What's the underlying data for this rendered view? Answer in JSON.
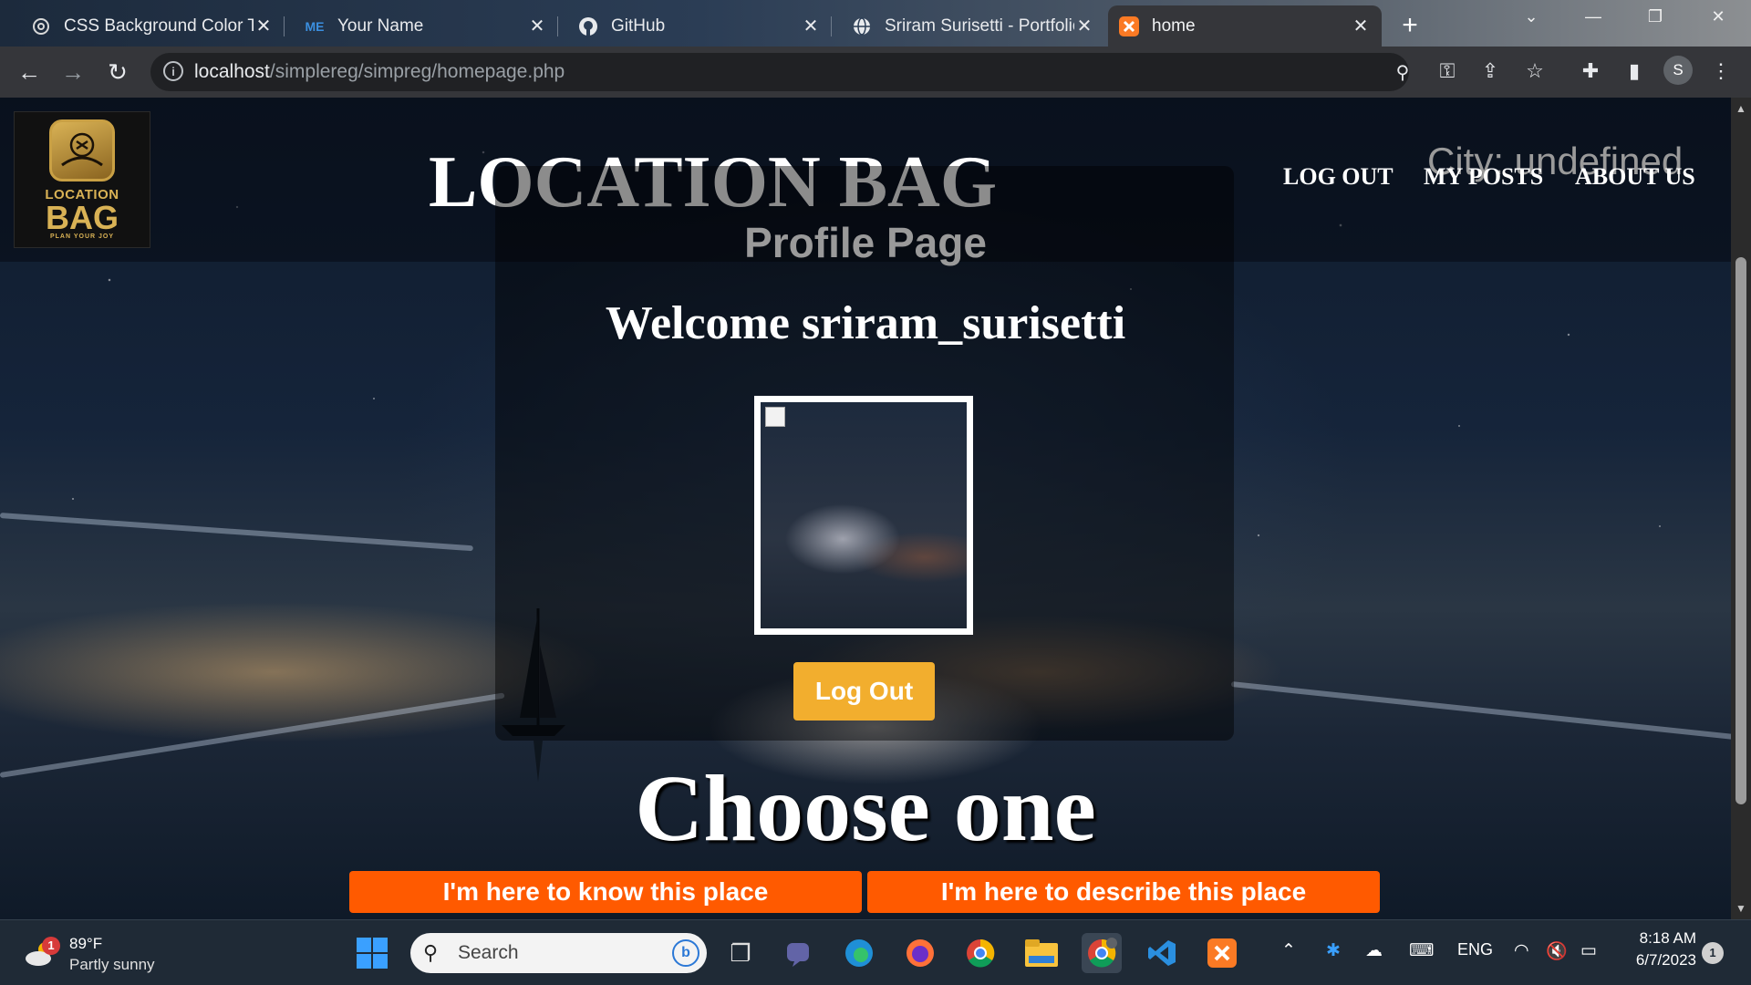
{
  "browser": {
    "tabs": [
      {
        "title": "CSS Background Color Tra",
        "icon": "chatgpt-icon"
      },
      {
        "title": "Your Name",
        "icon": "me-icon"
      },
      {
        "title": "GitHub",
        "icon": "github-icon"
      },
      {
        "title": "Sriram Surisetti - Portfolio",
        "icon": "globe-icon"
      },
      {
        "title": "home",
        "icon": "xampp-icon",
        "active": true
      }
    ],
    "url_host": "localhost",
    "url_path": "/simplereg/simpreg/homepage.php",
    "profile_initial": "S"
  },
  "site": {
    "logo": {
      "line1": "LOCATION",
      "line2": "BAG",
      "tagline": "PLAN YOUR JOY"
    },
    "title": "LOCATION BAG",
    "city": "City: undefined",
    "nav": [
      "LOG OUT",
      "MY POSTS",
      "ABOUT US"
    ]
  },
  "profile": {
    "heading": "Profile Page",
    "welcome": "Welcome sriram_surisetti",
    "logout_label": "Log Out"
  },
  "choose": {
    "heading": "Choose one",
    "options": [
      "I'm here to know this place",
      "I'm here to describe this place"
    ]
  },
  "colors": {
    "logout_button": "#f2ae2e",
    "option_button": "#ff5a00",
    "city_text": "#9a9a9a"
  },
  "taskbar": {
    "weather_badge": "1",
    "temperature": "89°F",
    "condition": "Partly sunny",
    "search_placeholder": "Search",
    "language": "ENG",
    "time": "8:18 AM",
    "date": "6/7/2023",
    "notification_count": "1"
  }
}
